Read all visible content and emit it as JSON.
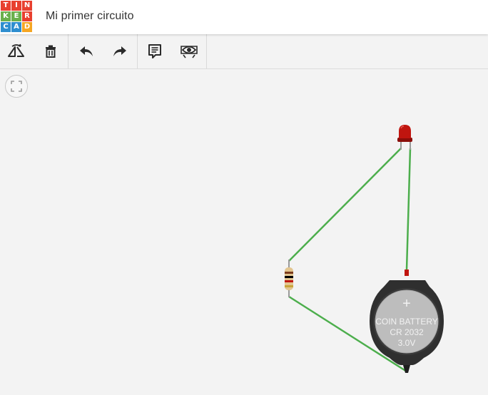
{
  "app": {
    "logo_letters": [
      "T",
      "I",
      "N",
      "K",
      "E",
      "R",
      "C",
      "A",
      "D"
    ],
    "logo_colors": [
      "#e8402f",
      "#e8402f",
      "#e8402f",
      "#6ab04c",
      "#6ab04c",
      "#e8402f",
      "#2e8ecf",
      "#2e8ecf",
      "#f5a623"
    ],
    "project_title": "Mi primer circuito"
  },
  "toolbar": {
    "buttons": [
      {
        "name": "rotate-button",
        "icon": "rotate-icon"
      },
      {
        "name": "delete-button",
        "icon": "trash-icon"
      },
      {
        "name": "undo-button",
        "icon": "undo-icon"
      },
      {
        "name": "redo-button",
        "icon": "redo-icon"
      },
      {
        "name": "notes-button",
        "icon": "notes-icon"
      },
      {
        "name": "visibility-button",
        "icon": "eye-icon"
      }
    ]
  },
  "canvas": {
    "fit_icon": "fit-view-icon",
    "battery": {
      "line1": "COIN BATTERY",
      "line2": "CR 2032",
      "line3": "3.0V",
      "plus_symbol": "+"
    },
    "wire_color": "#4cae4c",
    "led_color": "#c0150f"
  }
}
